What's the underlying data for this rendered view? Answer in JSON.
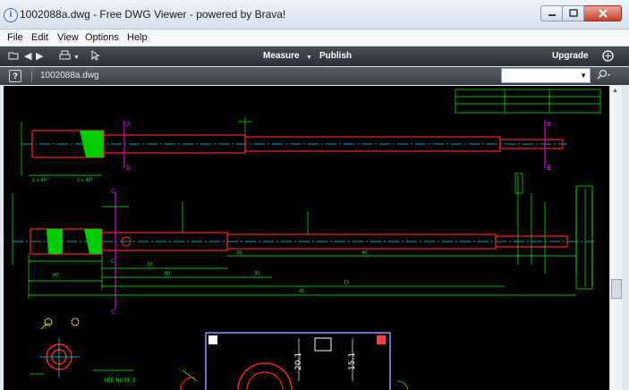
{
  "window": {
    "title": "1002088a.dwg - Free DWG Viewer - powered by Brava!",
    "app_icon": "info-circle-icon"
  },
  "menu": [
    "File",
    "Edit",
    "View",
    "Options",
    "Help"
  ],
  "toolbar": {
    "measure_label": "Measure",
    "publish_label": "Publish",
    "upgrade_label": "Upgrade"
  },
  "document": {
    "help_label": "?",
    "name": "1002088a.dwg"
  },
  "search": {
    "value": ""
  },
  "colors": {
    "drawing_bg": "#000000",
    "line_red": "#ff2020",
    "line_green": "#00ff00",
    "line_cyan": "#00d8ff",
    "line_magenta": "#ff00ff",
    "line_white": "#ffffff",
    "line_blue": "#6a6cff"
  },
  "drawing": {
    "labels": [
      "A",
      "A",
      "B",
      "B",
      "C",
      "C",
      "C",
      "SEE NOTE 3",
      "20.1",
      "15.1",
      "40",
      "30",
      "60",
      "30",
      "40",
      "15",
      "45",
      "30",
      "2 x 45°",
      "2 x 45°"
    ]
  }
}
